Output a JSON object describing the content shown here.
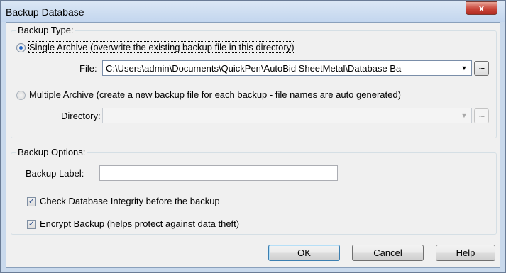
{
  "window": {
    "title": "Backup Database",
    "close_glyph": "x"
  },
  "backup_type": {
    "group_title": "Backup Type:",
    "single": {
      "label": "Single Archive (overwrite the existing backup file in this directory)",
      "selected": true,
      "file_label": "File:",
      "file_value": "C:\\Users\\admin\\Documents\\QuickPen\\AutoBid SheetMetal\\Database Ba"
    },
    "multiple": {
      "label": "Multiple Archive (create a new backup file for each backup - file names are auto generated)",
      "selected": false,
      "directory_label": "Directory:",
      "directory_value": ""
    },
    "browse_glyph": "..."
  },
  "backup_options": {
    "group_title": "Backup Options:",
    "label_field_label": "Backup Label:",
    "label_field_value": "",
    "check_integrity": {
      "label": "Check Database Integrity before the backup",
      "checked": true
    },
    "encrypt": {
      "label": "Encrypt Backup (helps protect against data theft)",
      "checked": true
    }
  },
  "buttons": {
    "ok": {
      "mnemonic": "O",
      "rest": "K"
    },
    "cancel": {
      "mnemonic": "C",
      "rest": "ancel"
    },
    "help": {
      "mnemonic": "H",
      "rest": "elp"
    }
  },
  "icons": {
    "close": "close-icon",
    "dropdown": "chevron-down-icon",
    "browse": "ellipsis-icon",
    "check": "checkmark-icon"
  },
  "colors": {
    "titlebar": "#c3d6ee",
    "close_button": "#c9463a",
    "dialog_face": "#f0f0f0",
    "radio_dot": "#1f63c5"
  }
}
